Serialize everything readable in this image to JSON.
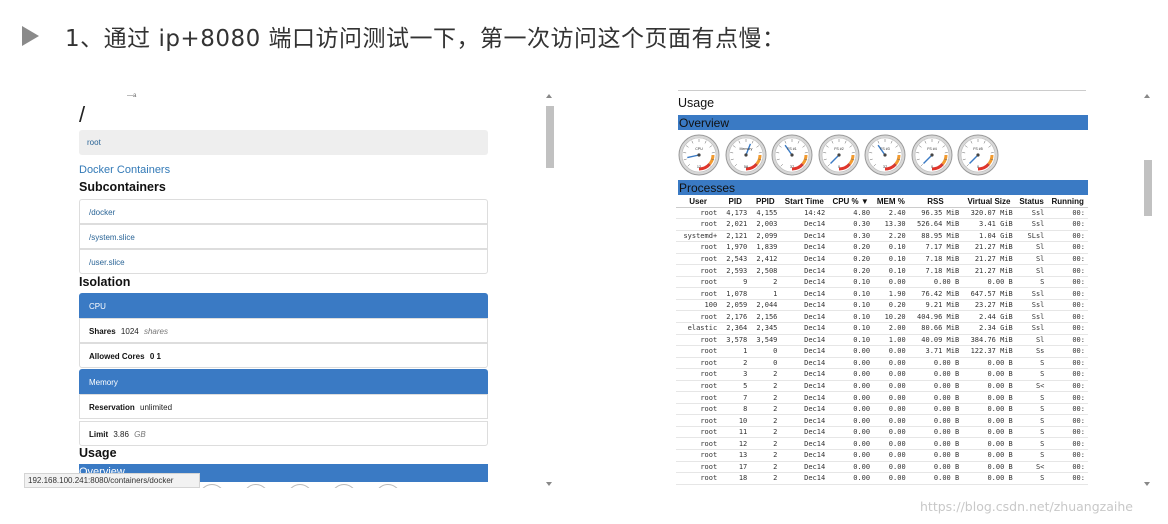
{
  "header": {
    "text": "1、通过 ip+8080 端口访问测试一下，第一次访问这个页面有点慢："
  },
  "left": {
    "slash": "/",
    "crumb": "root",
    "docker_link": "Docker Containers",
    "subcontainers_title": "Subcontainers",
    "subcontainers": [
      "/docker",
      "/system.slice",
      "/user.slice"
    ],
    "isolation_title": "Isolation",
    "cpu_header": "CPU",
    "shares_label": "Shares",
    "shares_value": "1024",
    "shares_unit": "shares",
    "cores_label": "Allowed Cores",
    "cores_value": "0 1",
    "memory_header": "Memory",
    "reservation_label": "Reservation",
    "reservation_value": "unlimited",
    "limit_label": "Limit",
    "limit_value": "3.86",
    "limit_unit": "GB",
    "usage_title": "Usage",
    "overview_title": "Overview",
    "status_url": "192.168.100.241:8080/containers/docker"
  },
  "right": {
    "usage_title": "Usage",
    "overview_title": "Overview",
    "processes_title": "Processes",
    "gauges": [
      {
        "label": "CPU",
        "value": "12"
      },
      {
        "label": "Memory",
        "value": "58"
      },
      {
        "label": "FS #1",
        "value": "37"
      },
      {
        "label": "FS #2",
        "value": "0"
      },
      {
        "label": "FS #3",
        "value": "37"
      },
      {
        "label": "FS #4",
        "value": "0"
      },
      {
        "label": "FS #5",
        "value": "0"
      }
    ],
    "columns": [
      "User",
      "PID",
      "PPID",
      "Start Time",
      "CPU % ▼",
      "MEM %",
      "RSS",
      "Virtual Size",
      "Status",
      "Running"
    ],
    "rows": [
      [
        "root",
        "4,173",
        "4,155",
        "14:42",
        "4.80",
        "2.40",
        "96.35 MiB",
        "320.07 MiB",
        "Ssl",
        "00:"
      ],
      [
        "root",
        "2,021",
        "2,003",
        "Dec14",
        "0.30",
        "13.30",
        "526.64 MiB",
        "3.41 GiB",
        "Ssl",
        "00:"
      ],
      [
        "systemd+",
        "2,121",
        "2,099",
        "Dec14",
        "0.30",
        "2.20",
        "88.95 MiB",
        "1.04 GiB",
        "SLsl",
        "00:"
      ],
      [
        "root",
        "1,970",
        "1,839",
        "Dec14",
        "0.20",
        "0.10",
        "7.17 MiB",
        "21.27 MiB",
        "Sl",
        "00:"
      ],
      [
        "root",
        "2,543",
        "2,412",
        "Dec14",
        "0.20",
        "0.10",
        "7.18 MiB",
        "21.27 MiB",
        "Sl",
        "00:"
      ],
      [
        "root",
        "2,593",
        "2,508",
        "Dec14",
        "0.20",
        "0.10",
        "7.18 MiB",
        "21.27 MiB",
        "Sl",
        "00:"
      ],
      [
        "root",
        "9",
        "2",
        "Dec14",
        "0.10",
        "0.00",
        "0.00 B",
        "0.00 B",
        "S",
        "00:"
      ],
      [
        "root",
        "1,078",
        "1",
        "Dec14",
        "0.10",
        "1.90",
        "76.42 MiB",
        "647.57 MiB",
        "Ssl",
        "00:"
      ],
      [
        "100",
        "2,059",
        "2,044",
        "Dec14",
        "0.10",
        "0.20",
        "9.21 MiB",
        "23.27 MiB",
        "Ssl",
        "00:"
      ],
      [
        "root",
        "2,176",
        "2,156",
        "Dec14",
        "0.10",
        "10.20",
        "404.96 MiB",
        "2.44 GiB",
        "Ssl",
        "00:"
      ],
      [
        "elastic",
        "2,364",
        "2,345",
        "Dec14",
        "0.10",
        "2.00",
        "80.66 MiB",
        "2.34 GiB",
        "Ssl",
        "00:"
      ],
      [
        "root",
        "3,578",
        "3,549",
        "Dec14",
        "0.10",
        "1.00",
        "40.09 MiB",
        "384.76 MiB",
        "Sl",
        "00:"
      ],
      [
        "root",
        "1",
        "0",
        "Dec14",
        "0.00",
        "0.00",
        "3.71 MiB",
        "122.37 MiB",
        "Ss",
        "00:"
      ],
      [
        "root",
        "2",
        "0",
        "Dec14",
        "0.00",
        "0.00",
        "0.00 B",
        "0.00 B",
        "S",
        "00:"
      ],
      [
        "root",
        "3",
        "2",
        "Dec14",
        "0.00",
        "0.00",
        "0.00 B",
        "0.00 B",
        "S",
        "00:"
      ],
      [
        "root",
        "5",
        "2",
        "Dec14",
        "0.00",
        "0.00",
        "0.00 B",
        "0.00 B",
        "S<",
        "00:"
      ],
      [
        "root",
        "7",
        "2",
        "Dec14",
        "0.00",
        "0.00",
        "0.00 B",
        "0.00 B",
        "S",
        "00:"
      ],
      [
        "root",
        "8",
        "2",
        "Dec14",
        "0.00",
        "0.00",
        "0.00 B",
        "0.00 B",
        "S",
        "00:"
      ],
      [
        "root",
        "10",
        "2",
        "Dec14",
        "0.00",
        "0.00",
        "0.00 B",
        "0.00 B",
        "S",
        "00:"
      ],
      [
        "root",
        "11",
        "2",
        "Dec14",
        "0.00",
        "0.00",
        "0.00 B",
        "0.00 B",
        "S",
        "00:"
      ],
      [
        "root",
        "12",
        "2",
        "Dec14",
        "0.00",
        "0.00",
        "0.00 B",
        "0.00 B",
        "S",
        "00:"
      ],
      [
        "root",
        "13",
        "2",
        "Dec14",
        "0.00",
        "0.00",
        "0.00 B",
        "0.00 B",
        "S",
        "00:"
      ],
      [
        "root",
        "17",
        "2",
        "Dec14",
        "0.00",
        "0.00",
        "0.00 B",
        "0.00 B",
        "S<",
        "00:"
      ],
      [
        "root",
        "18",
        "2",
        "Dec14",
        "0.00",
        "0.00",
        "0.00 B",
        "0.00 B",
        "S",
        "00:"
      ]
    ]
  },
  "watermark": "https://blog.csdn.net/zhuangzaihe",
  "colors": {
    "primary": "#3a7ac4",
    "link": "#337ab7",
    "gauge_red": "#e0352b",
    "gauge_orange": "#f29a2e"
  }
}
